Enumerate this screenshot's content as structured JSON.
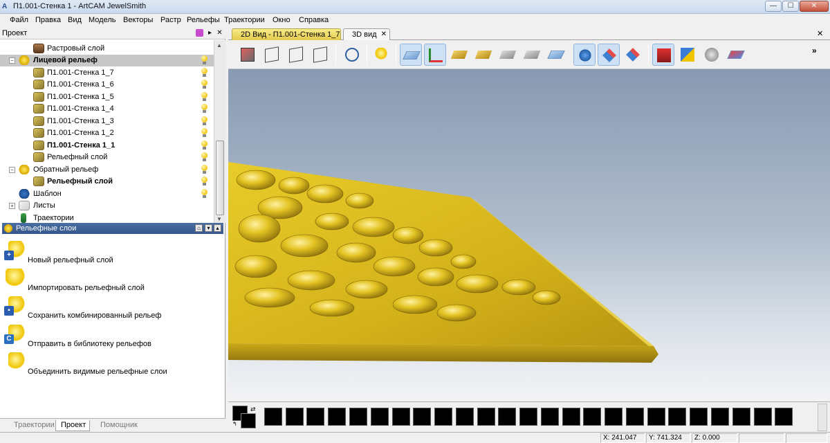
{
  "window": {
    "title": "П1.001-Стенка 1 - ArtCAM JewelSmith",
    "app_icon": "A",
    "min": "—",
    "max": "☐",
    "close": "✕"
  },
  "menu": [
    "Файл",
    "Правка",
    "Вид",
    "Модель",
    "Векторы",
    "Растр",
    "Рельефы",
    "Траектории",
    "Окно",
    "Справка"
  ],
  "project_panel": {
    "title": "Проект",
    "close": "✕",
    "tree": [
      {
        "label": "Растровый слой",
        "bold": false,
        "bulb": false
      },
      {
        "label": "Лицевой рельеф",
        "bold": true,
        "bulb": true
      },
      {
        "label": "П1.001-Стенка 1_7",
        "bold": false,
        "bulb": true
      },
      {
        "label": "П1.001-Стенка 1_6",
        "bold": false,
        "bulb": true
      },
      {
        "label": "П1.001-Стенка 1_5",
        "bold": false,
        "bulb": true
      },
      {
        "label": "П1.001-Стенка 1_4",
        "bold": false,
        "bulb": true
      },
      {
        "label": "П1.001-Стенка 1_3",
        "bold": false,
        "bulb": true
      },
      {
        "label": "П1.001-Стенка 1_2",
        "bold": false,
        "bulb": true
      },
      {
        "label": "П1.001-Стенка 1_1",
        "bold": true,
        "bulb": true
      },
      {
        "label": "Рельефный слой",
        "bold": false,
        "bulb": true
      },
      {
        "label": "Обратный рельеф",
        "bold": false,
        "bulb": true
      },
      {
        "label": "Рельефный слой",
        "bold": true,
        "bulb": true
      },
      {
        "label": "Шаблон",
        "bold": false,
        "bulb": true
      },
      {
        "label": "Листы",
        "bold": false,
        "bulb": false
      },
      {
        "label": "Траектории",
        "bold": false,
        "bulb": false
      }
    ]
  },
  "relief_layers_panel": {
    "title": "Рельефные слои",
    "actions": [
      {
        "label": "Новый рельефный слой",
        "badge": "+",
        "badge_color": "#2a5db0"
      },
      {
        "label": "Импортировать рельефный слой",
        "badge": "",
        "badge_color": ""
      },
      {
        "label": "Сохранить комбинированный рельеф",
        "badge": "▪",
        "badge_color": "#2a5db0"
      },
      {
        "label": "Отправить в библиотеку рельефов",
        "badge": "C",
        "badge_color": "#2a6fc0"
      },
      {
        "label": "Объединить видимые рельефные слои",
        "badge": "",
        "badge_color": ""
      }
    ]
  },
  "bottom_tabs": [
    "Траектории",
    "Проект",
    "Помощник"
  ],
  "doc_tabs": {
    "tab_2d": "2D Вид - П1.001-Стенка 1_7",
    "tab_3d": "3D вид",
    "close": "✕",
    "doc_close": "✕"
  },
  "toolbar": {
    "more": "»"
  },
  "status": {
    "x": "X: 241.047",
    "y": "Y: 741.324",
    "z": "Z: 0.000"
  },
  "colors": {
    "relief_gold": "#e2c318",
    "selection_header": "#34568a"
  }
}
